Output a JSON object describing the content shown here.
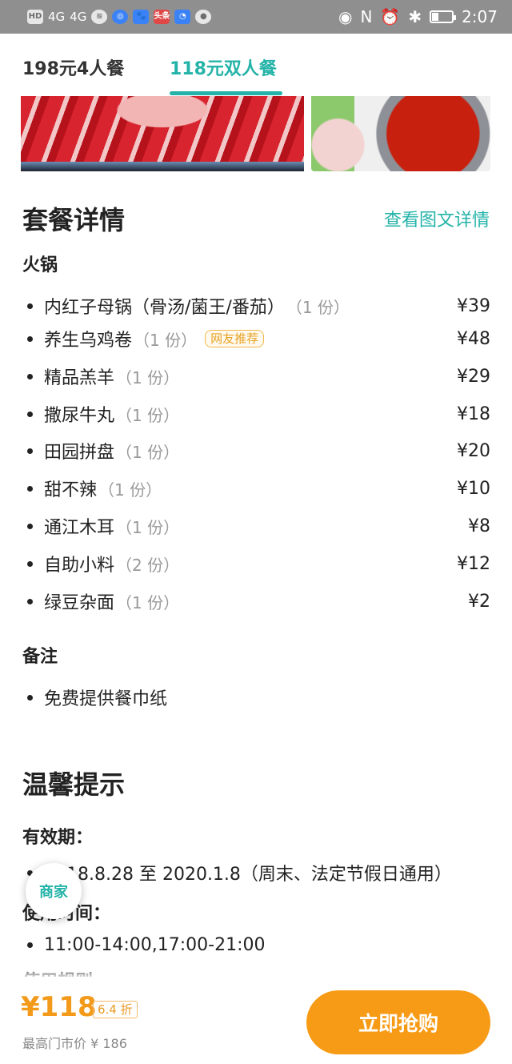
{
  "status_bar": {
    "left_tag": "HD",
    "net1": "4G",
    "net2": "4G",
    "app_tag": "头条",
    "time": "2:07"
  },
  "tabs": [
    {
      "label": "198元4人餐",
      "selected": false
    },
    {
      "label": "118元双人餐",
      "selected": true
    }
  ],
  "package": {
    "title": "套餐详情",
    "detail_link": "查看图文详情",
    "category": "火锅",
    "items": [
      {
        "name": "内红子母锅（骨汤/菌王/番茄）",
        "qty": "（1 份）",
        "price": "¥39"
      },
      {
        "name": "养生乌鸡卷",
        "qty": "（1 份）",
        "price": "¥48",
        "badge": "网友推荐"
      },
      {
        "name": "精品羔羊",
        "qty": "（1 份）",
        "price": "¥29"
      },
      {
        "name": "撒尿牛丸",
        "qty": "（1 份）",
        "price": "¥18"
      },
      {
        "name": "田园拼盘",
        "qty": "（1 份）",
        "price": "¥20"
      },
      {
        "name": "甜不辣",
        "qty": "（1 份）",
        "price": "¥10"
      },
      {
        "name": "通江木耳",
        "qty": "（1 份）",
        "price": "¥8"
      },
      {
        "name": "自助小料",
        "qty": "（2 份）",
        "price": "¥12"
      },
      {
        "name": "绿豆杂面",
        "qty": "（1 份）",
        "price": "¥2"
      }
    ],
    "notes_title": "备注",
    "notes": [
      "免费提供餐巾纸"
    ]
  },
  "tips": {
    "title": "温馨提示",
    "validity_label": "有效期：",
    "validity_value": "2018.8.28 至 2020.1.8（周末、法定节假日通用）",
    "time_label": "使用时间：",
    "time_value": "11:00-14:00,17:00-21:00",
    "rules_label": "使用规则"
  },
  "shop_button": "商家",
  "bottom": {
    "price": "¥118",
    "discount": "6.4 折",
    "market_price": "最高门市价 ¥ 186",
    "buy_label": "立即抢购"
  },
  "colors": {
    "accent": "#24b3a8",
    "buy": "#f79b16",
    "price": "#f39a1b"
  }
}
